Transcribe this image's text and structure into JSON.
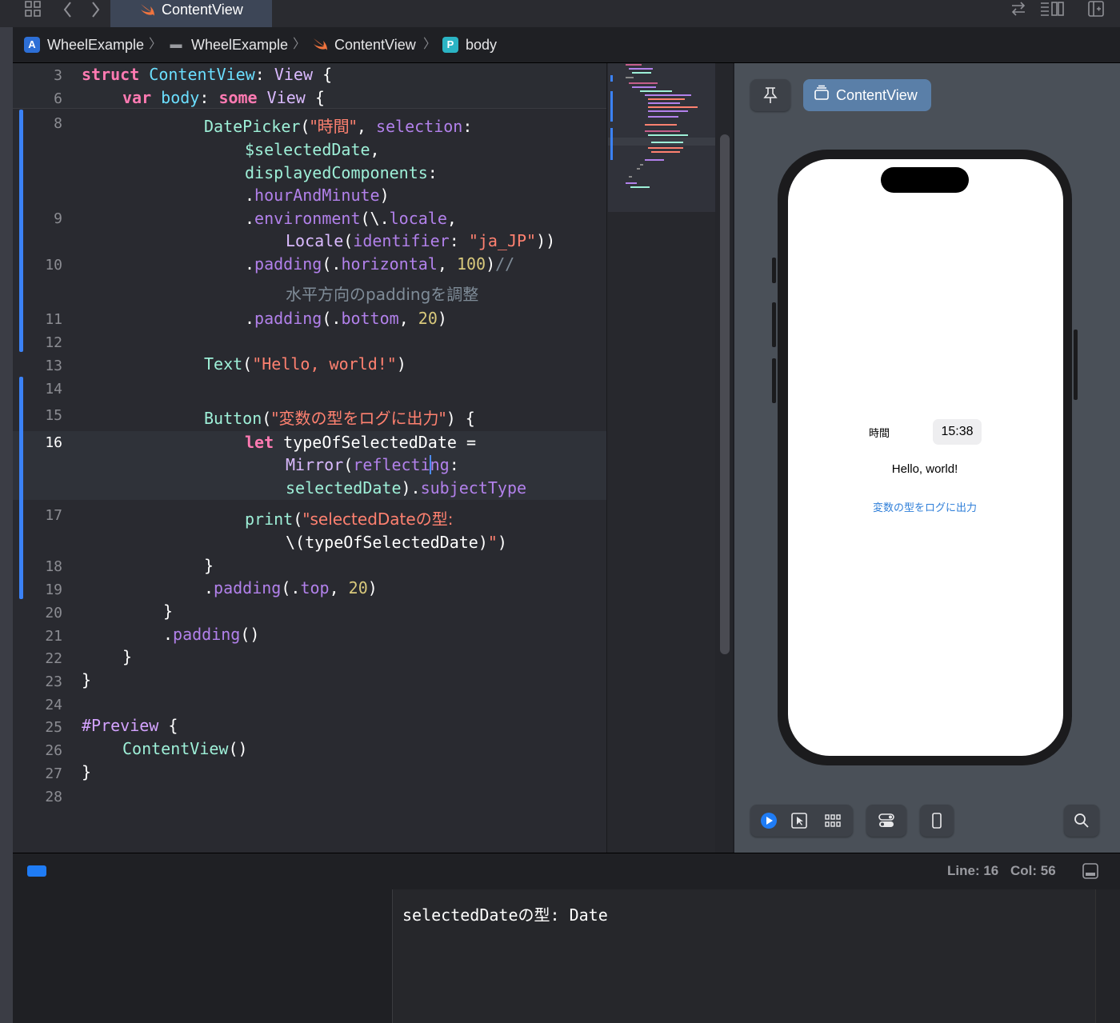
{
  "tab": {
    "label": "ContentView"
  },
  "breadcrumb": {
    "items": [
      "WheelExample",
      "WheelExample",
      "ContentView",
      "body"
    ],
    "sep": "〉"
  },
  "sticky": {
    "l3_num": "3",
    "l3_kw": "struct",
    "l3_name": "ContentView",
    "l3_colon": ":",
    "l3_type": "View",
    "l3_brace": "{",
    "l6_num": "6",
    "l6_kw": "var",
    "l6_name": "body",
    "l6_colon": ":",
    "l6_some": "some",
    "l6_type": "View",
    "l6_brace": "{"
  },
  "lines": {
    "n8": "8",
    "n9": "9",
    "n10": "10",
    "n11": "11",
    "n12": "12",
    "n13": "13",
    "n14": "14",
    "n15": "15",
    "n16": "16",
    "n17": "17",
    "n18": "18",
    "n19": "19",
    "n20": "20",
    "n21": "21",
    "n22": "22",
    "n23": "23",
    "n24": "24",
    "n25": "25",
    "n26": "26",
    "n27": "27",
    "n28": "28"
  },
  "code": {
    "c8_fn": "DatePicker",
    "c8_p": "(",
    "c8_str": "\"時間\"",
    "c8_comma": ", ",
    "c8_arg": "selection",
    "c8_col": ":",
    "c8b": "$selectedDate",
    "c8b_c": ",",
    "c8c": "displayedComponents",
    "c8c_col": ":",
    "c8d_dot": ".",
    "c8d": "hourAndMinute",
    "c8d_p": ")",
    "c9_dot": ".",
    "c9_fn": "environment",
    "c9_p": "(\\.",
    "c9_m": "locale",
    "c9_c": ",",
    "c9b_fn": "Locale",
    "c9b_p": "(",
    "c9b_arg": "identifier",
    "c9b_col": ": ",
    "c9b_str": "\"ja_JP\"",
    "c9b_end": "))",
    "c10_dot": ".",
    "c10_fn": "padding",
    "c10_p": "(.",
    "c10_m": "horizontal",
    "c10_c": ", ",
    "c10_num": "100",
    "c10_end": ")",
    "c10_cmt": "//",
    "c10b_cmt": "水平方向のpaddingを調整",
    "c11_dot": ".",
    "c11_fn": "padding",
    "c11_p": "(.",
    "c11_m": "bottom",
    "c11_c": ", ",
    "c11_num": "20",
    "c11_end": ")",
    "c13_fn": "Text",
    "c13_p": "(",
    "c13_str": "\"Hello, world!\"",
    "c13_end": ")",
    "c15_fn": "Button",
    "c15_p": "(",
    "c15_str": "\"変数の型をログに出力\"",
    "c15_end": ") {",
    "c16_kw": "let",
    "c16_var": " typeOfSelectedDate =",
    "c16b_fn": "Mirror",
    "c16b_p": "(",
    "c16b_arg": "reflecting",
    "c16b_col": ":",
    "c16c_var": "selectedDate",
    "c16c_p": ").",
    "c16c_m": "subjectType",
    "c17_fn": "print",
    "c17_p": "(",
    "c17_str": "\"selectedDateの型:",
    "c17b_i": "\\(typeOfSelectedDate)",
    "c17b_str": "\"",
    "c17b_end": ")",
    "c18": "}",
    "c19_dot": ".",
    "c19_fn": "padding",
    "c19_p": "(.",
    "c19_m": "top",
    "c19_c": ", ",
    "c19_num": "20",
    "c19_end": ")",
    "c20": "}",
    "c21_dot": ".",
    "c21_fn": "padding",
    "c21_end": "()",
    "c22": "}",
    "c23": "}",
    "c25_kw": "#Preview",
    "c25_b": " {",
    "c26_fn": "ContentView",
    "c26_end": "()",
    "c27": "}"
  },
  "canvas": {
    "view_label": "ContentView",
    "preview": {
      "picker_label": "時間",
      "picker_value": "15:38",
      "text": "Hello, world!",
      "button": "変数の型をログに出力"
    }
  },
  "status": {
    "line": "Line: 16",
    "col": "Col: 56"
  },
  "console": {
    "output": "selectedDateの型: Date"
  },
  "colors": {
    "accent": "#3b82f6",
    "link": "#2f7fd9",
    "keyword": "#ff7ab2",
    "string": "#ff8170"
  }
}
